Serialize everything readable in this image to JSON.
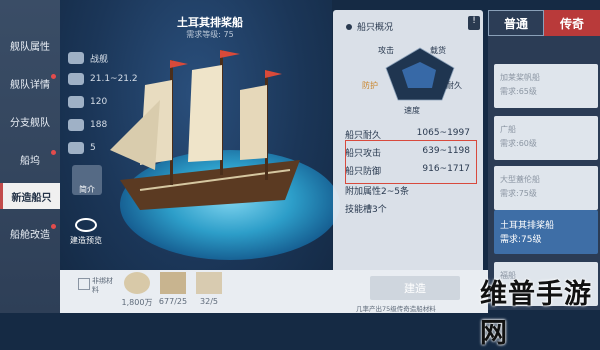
{
  "nav": {
    "items": [
      {
        "label": "舰队属性"
      },
      {
        "label": "舰队详情",
        "dot": true
      },
      {
        "label": "分支舰队"
      },
      {
        "label": "船坞",
        "dot": true
      },
      {
        "label": "新造船只",
        "active": true
      },
      {
        "label": "船舱改造",
        "dot": true
      }
    ]
  },
  "ship": {
    "name": "土耳其排桨船",
    "requirement": "需求等级: 75",
    "stats": [
      {
        "icon": "warship-icon",
        "value": "战舰"
      },
      {
        "icon": "hull-icon",
        "value": "21.1~21.2"
      },
      {
        "icon": "crew-icon",
        "value": "120"
      },
      {
        "icon": "cargo-icon",
        "value": "188"
      },
      {
        "icon": "cannon-icon",
        "value": "5"
      }
    ],
    "intro_label": "简介",
    "preview_label": "建造预览"
  },
  "overview": {
    "title": "船只概况",
    "radar_labels": {
      "attack": "攻击",
      "cargo": "载货",
      "defense": "防护",
      "durability": "耐久",
      "speed": "速度"
    },
    "rows": [
      {
        "label": "船只耐久",
        "value": "1065~1997"
      },
      {
        "label": "船只攻击",
        "value": "639~1198"
      },
      {
        "label": "船只防御",
        "value": "916~1717"
      },
      {
        "label": "附加属性",
        "value": "2~5条"
      },
      {
        "label": "技能槽3个",
        "value": ""
      }
    ]
  },
  "tabs": {
    "normal": "普通",
    "legend": "传奇"
  },
  "list": [
    {
      "name": "加莱桨帆船",
      "req": "需求:65级"
    },
    {
      "name": "广船",
      "req": "需求:60级"
    },
    {
      "name": "大型蓋伦船",
      "req": "需求:75级"
    },
    {
      "name": "土耳其排桨船",
      "req": "需求:75级",
      "selected": true
    },
    {
      "name": "福船",
      "req": ""
    }
  ],
  "bottom": {
    "resources": [
      {
        "label": "非绑材料"
      },
      {
        "value": "1,800万"
      },
      {
        "value": "677/25"
      },
      {
        "value": "32/5"
      }
    ],
    "build": "建造",
    "note": "几率产出75级传奇造船材料",
    "watermark": "维普手游网"
  },
  "colors": {
    "accent_red": "#d84a3d",
    "selected_card": "#3e6ea6",
    "legend_tab": "#b93a3a"
  }
}
